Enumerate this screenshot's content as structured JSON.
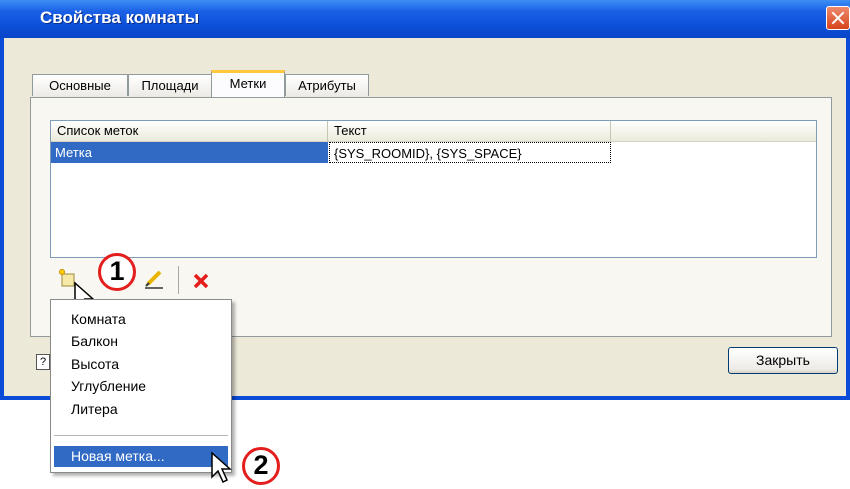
{
  "window": {
    "title": "Свойства комнаты"
  },
  "tabs": [
    {
      "label": "Основные"
    },
    {
      "label": "Площади"
    },
    {
      "label": "Метки"
    },
    {
      "label": "Атрибуты"
    }
  ],
  "active_tab": "Метки",
  "list": {
    "columns": [
      "Список меток",
      "Текст"
    ],
    "rows": [
      {
        "name": "Метка",
        "text": "{SYS_ROOMID}, {SYS_SPACE}",
        "selected": true
      }
    ]
  },
  "toolbar": {
    "icons": [
      "add-label-icon",
      "edit-pencil-icon",
      "delete-x-icon"
    ]
  },
  "callouts": [
    "1",
    "2"
  ],
  "dropdown_menu": {
    "items": [
      {
        "label": "Комната"
      },
      {
        "label": "Балкон"
      },
      {
        "label": "Высота"
      },
      {
        "label": "Углубление"
      },
      {
        "label": "Литера"
      },
      {
        "label": "Новая метка...",
        "highlighted": true
      }
    ]
  },
  "buttons": {
    "close_label": "Закрыть",
    "help_label": "?"
  },
  "colors": {
    "titlebar": "#0b4fd8",
    "selection": "#316ac5",
    "callout_ring": "#e41d1d",
    "delete_icon": "#e41d1d",
    "active_tab_accent": "#ffc83c"
  }
}
